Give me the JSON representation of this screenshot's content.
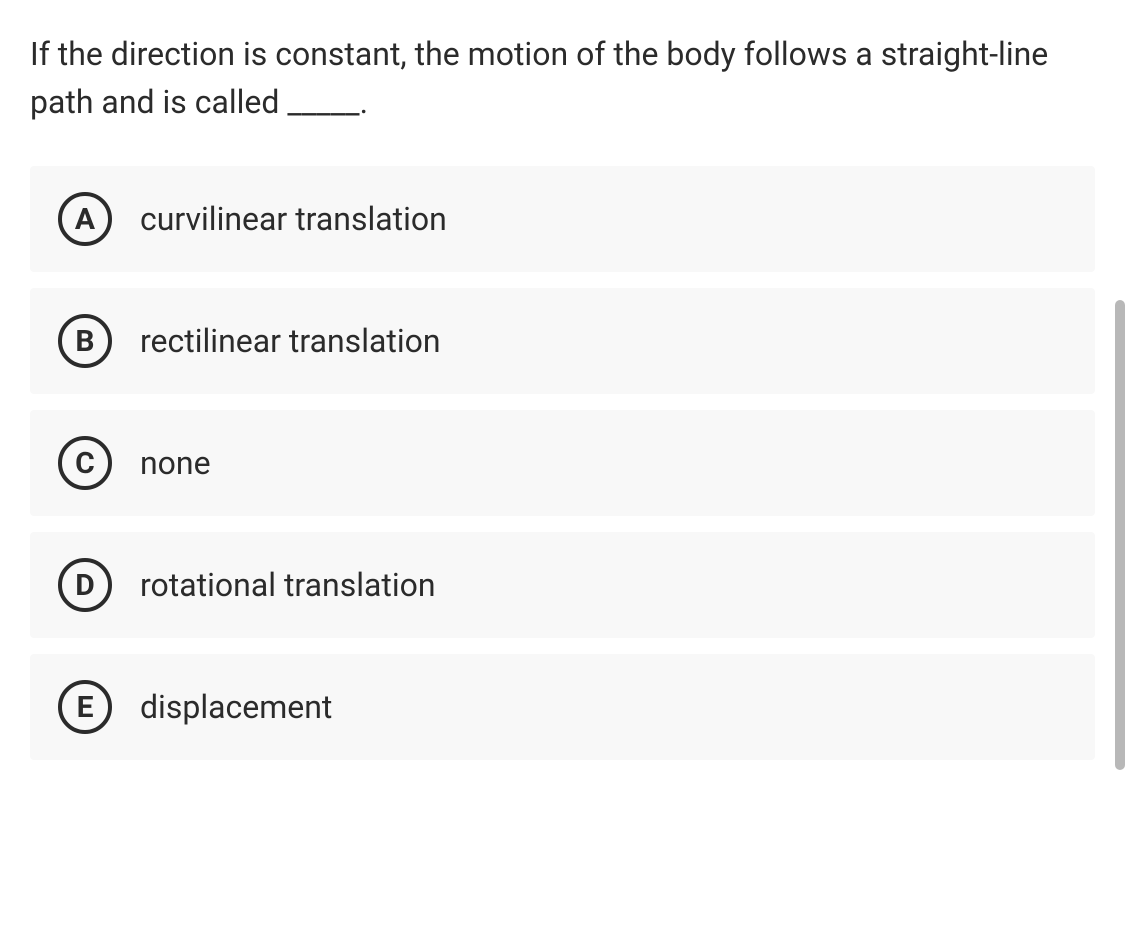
{
  "question": "If the direction is constant, the motion of the body follows a straight-line path and is called _____.",
  "options": [
    {
      "letter": "A",
      "text": "curvilinear translation"
    },
    {
      "letter": "B",
      "text": "rectilinear translation"
    },
    {
      "letter": "C",
      "text": "none"
    },
    {
      "letter": "D",
      "text": "rotational translation"
    },
    {
      "letter": "E",
      "text": "displacement"
    }
  ]
}
